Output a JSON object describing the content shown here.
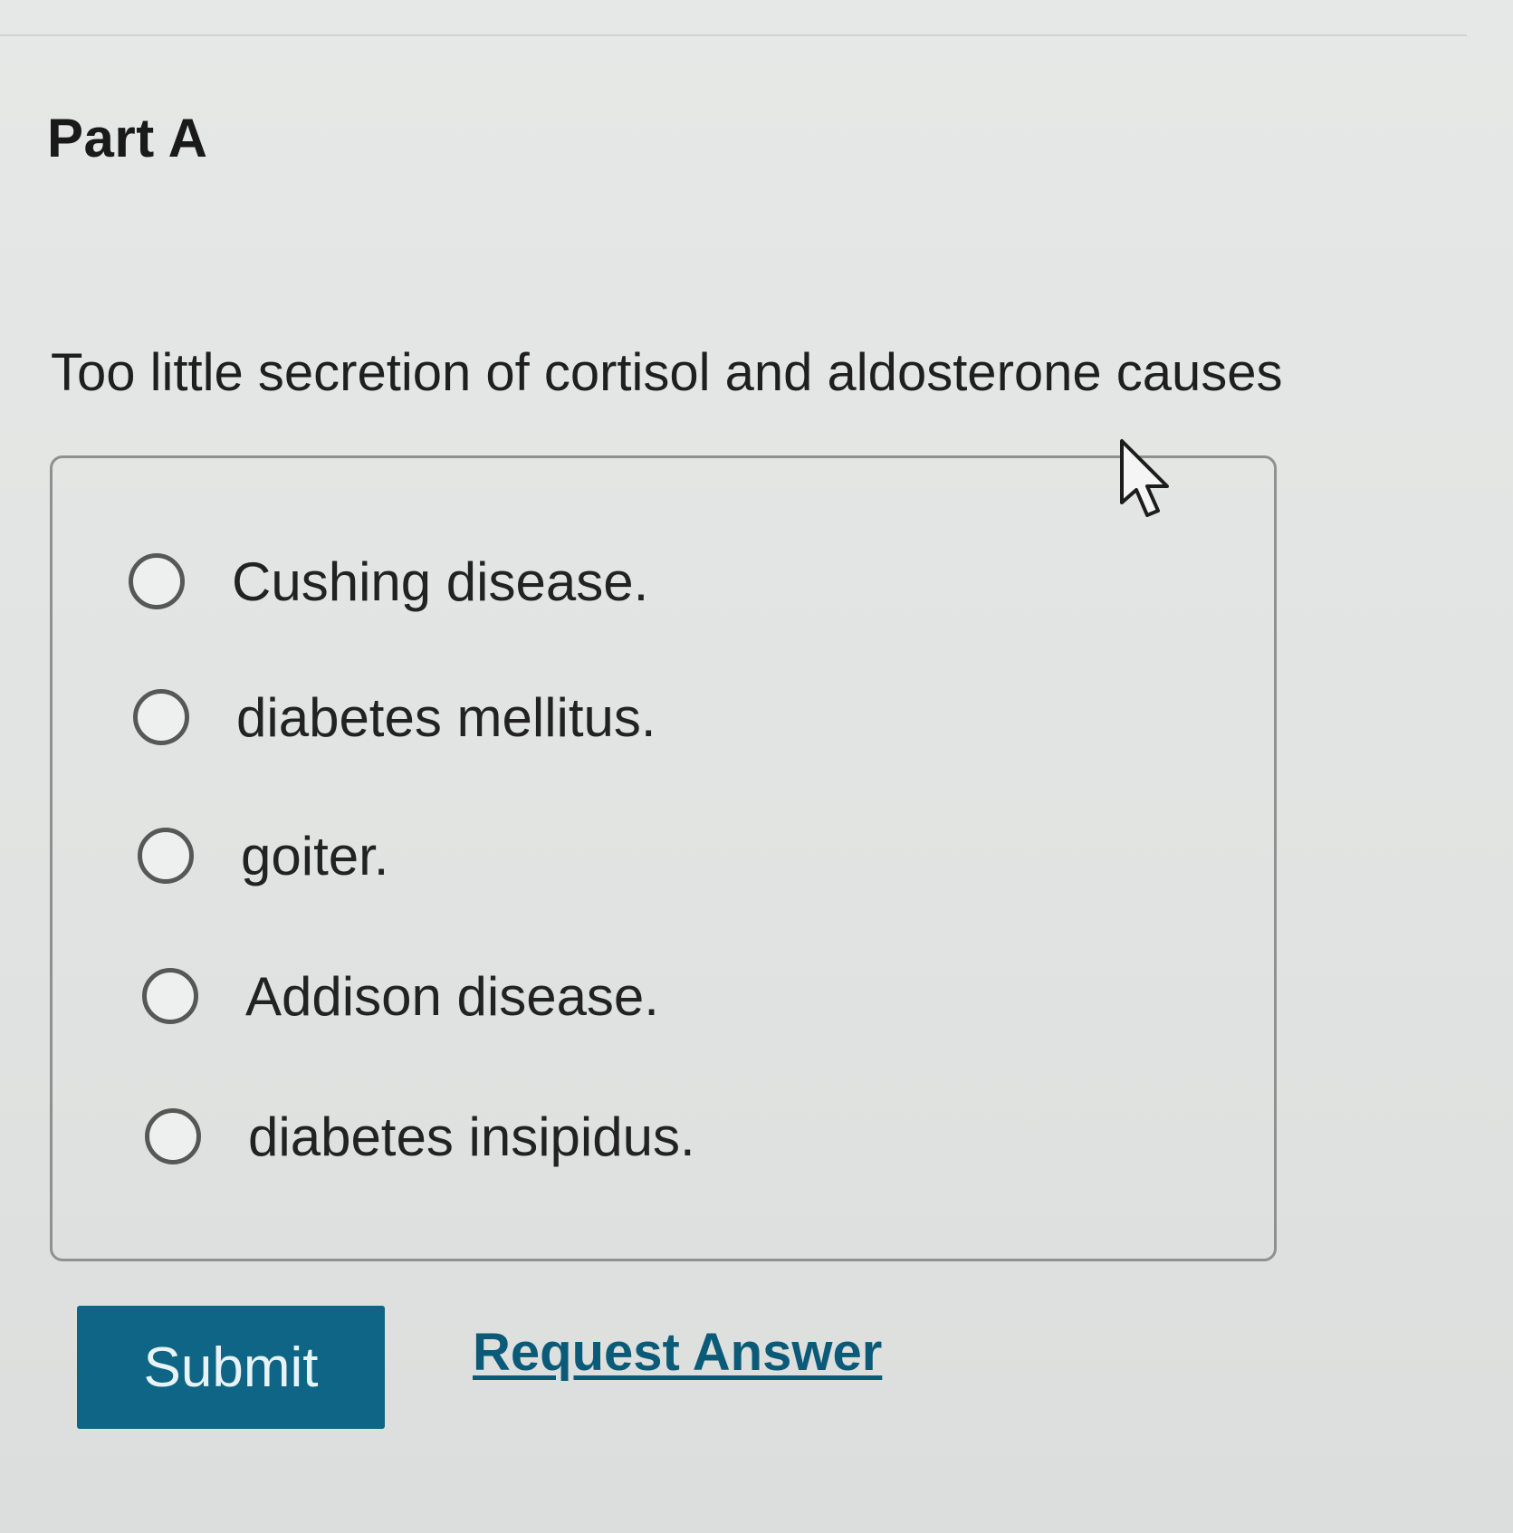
{
  "part": {
    "title": "Part A"
  },
  "question": {
    "text": "Too little secretion of cortisol and aldosterone causes"
  },
  "options": [
    {
      "label": "Cushing disease.",
      "selected": false
    },
    {
      "label": "diabetes mellitus.",
      "selected": false
    },
    {
      "label": "goiter.",
      "selected": false
    },
    {
      "label": "Addison disease.",
      "selected": false
    },
    {
      "label": "diabetes insipidus.",
      "selected": false
    }
  ],
  "actions": {
    "submit_label": "Submit",
    "request_answer_label": "Request Answer"
  },
  "colors": {
    "submit_background": "#0f6585",
    "link": "#0b5b78"
  },
  "icons": {
    "pointer": "mouse-pointer-icon"
  }
}
